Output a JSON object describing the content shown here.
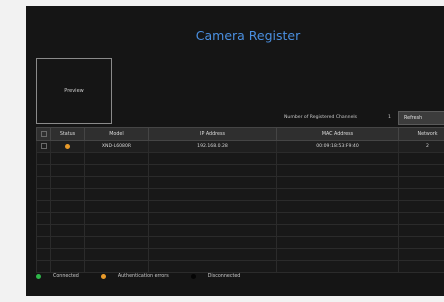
{
  "title": "Camera Register",
  "preview": {
    "label": "Preview"
  },
  "registered": {
    "label": "Number of Registered Channels",
    "count": "1"
  },
  "refresh_label": "Refresh",
  "table": {
    "headers": [
      "Status",
      "Model",
      "IP Address",
      "MAC Address",
      "Network"
    ],
    "rows": [
      {
        "status_color": "#e89a2a",
        "model": "XND-L6080R",
        "ip": "192.168.0.28",
        "mac": "00:09:18:53:F9:40",
        "network": "2"
      }
    ],
    "empty_rows": 10
  },
  "legend": [
    {
      "label": "Connected",
      "color": "#2fb84a"
    },
    {
      "label": "Authentication errors",
      "color": "#e89a2a"
    },
    {
      "label": "Disconnected",
      "color": "#050505"
    }
  ]
}
